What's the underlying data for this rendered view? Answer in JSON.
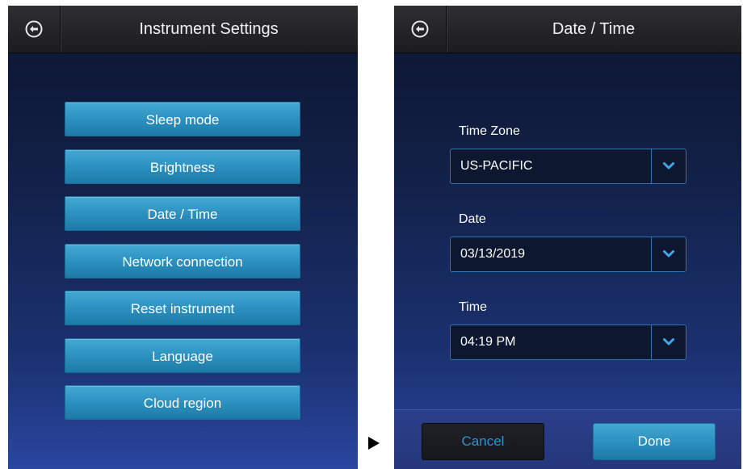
{
  "left_screen": {
    "title": "Instrument Settings",
    "back_icon": "back-arrow-circle-icon",
    "menu_items": [
      {
        "label": "Sleep mode"
      },
      {
        "label": "Brightness"
      },
      {
        "label": "Date / Time"
      },
      {
        "label": "Network connection"
      },
      {
        "label": "Reset instrument"
      },
      {
        "label": "Language"
      },
      {
        "label": "Cloud region"
      }
    ]
  },
  "transition_icon": "play-triangle-icon",
  "right_screen": {
    "title": "Date / Time",
    "back_icon": "back-arrow-circle-icon",
    "fields": [
      {
        "label": "Time Zone",
        "value": "US-PACIFIC"
      },
      {
        "label": "Date",
        "value": "03/13/2019"
      },
      {
        "label": "Time",
        "value": "04:19 PM"
      }
    ],
    "cancel_label": "Cancel",
    "done_label": "Done"
  },
  "colors": {
    "accent_button": "#2a8fbd",
    "cancel_text": "#2d94d0",
    "dropdown_border": "#2c74b4",
    "title_bar": "#262629"
  }
}
